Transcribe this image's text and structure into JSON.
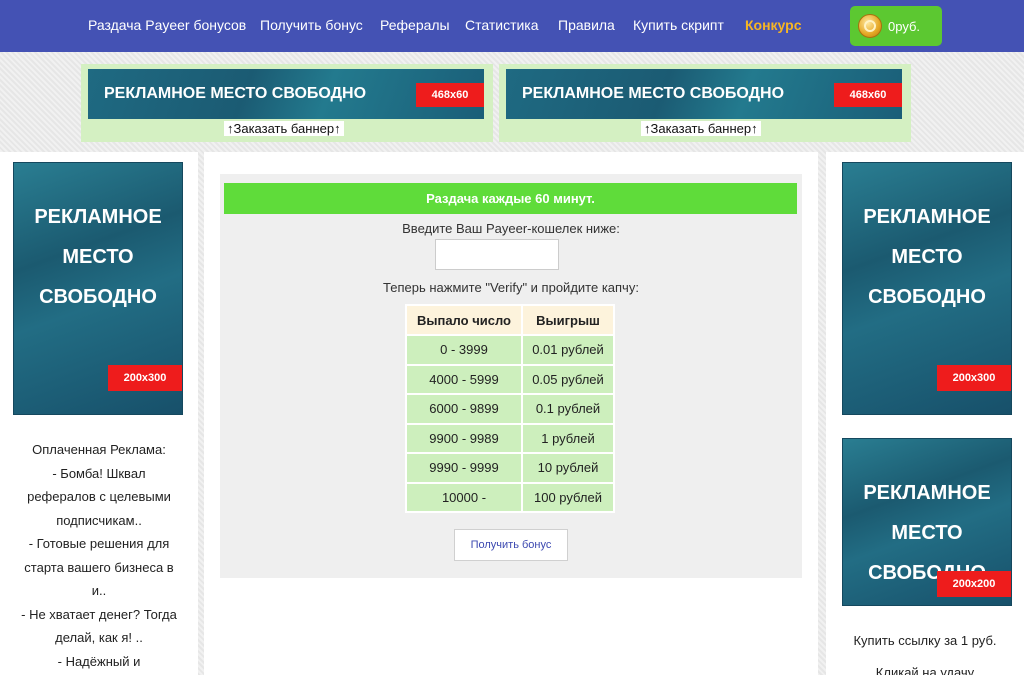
{
  "nav": {
    "items": [
      "Раздача Payeer бонусов",
      "Получить бонус",
      "Рефералы",
      "Статистика",
      "Правила",
      "Купить скрипт"
    ],
    "contest": "Конкурс",
    "balance": "0руб."
  },
  "top_banners": [
    {
      "text": "РЕКЛАМНОЕ  МЕСТО СВОБОДНО",
      "size": "468x60",
      "order": "↑Заказать баннер↑"
    },
    {
      "text": "РЕКЛАМНОЕ  МЕСТО СВОБОДНО",
      "size": "468x60",
      "order": "↑Заказать баннер↑"
    }
  ],
  "side_banners": {
    "left": {
      "lines": [
        "РЕКЛАМНОЕ",
        "МЕСТО",
        "СВОБОДНО"
      ],
      "size": "200x300"
    },
    "right_top": {
      "lines": [
        "РЕКЛАМНОЕ",
        "МЕСТО",
        "СВОБОДНО"
      ],
      "size": "200x300"
    },
    "right_bottom": {
      "lines": [
        "РЕКЛАМНОЕ",
        "МЕСТО",
        "СВОБОДНО"
      ],
      "size": "200x200"
    }
  },
  "paid_ads": {
    "title": "Оплаченная Реклама:",
    "lines": [
      "- Бомба! Шквал",
      "рефералов с целевыми",
      "подписчикам..",
      "- Готовые решения для",
      "старта вашего бизнеса в",
      "и..",
      "- Не хватает денег? Тогда",
      "делай, как я! ..",
      "- Надёжный и"
    ]
  },
  "right_links": {
    "buy_link": "Купить ссылку за 1 руб.",
    "luck": "Кликай на удачу"
  },
  "main": {
    "header": "Раздача каждые 60 минут.",
    "wallet_prompt": "Введите Ваш Payeer-кошелек ниже:",
    "wallet_value": "",
    "verify_prompt": "Теперь нажмите \"Verify\" и пройдите капчу:",
    "table": {
      "headers": [
        "Выпало число",
        "Выигрыш"
      ],
      "rows": [
        [
          "0 - 3999",
          "0.01 рублей"
        ],
        [
          "4000 - 5999",
          "0.05 рублей"
        ],
        [
          "6000 - 9899",
          "0.1 рублей"
        ],
        [
          "9900 - 9989",
          "1 рублей"
        ],
        [
          "9990 - 9999",
          "10 рублей"
        ],
        [
          "10000 -",
          "100 рублей"
        ]
      ]
    },
    "button": "Получить бонус"
  },
  "colors": {
    "nav_bg": "#4452b4",
    "contest": "#f6b524",
    "balance_bg": "#5cc831",
    "header_green": "#5fdc3a",
    "size_tag_red": "#ee1c1c"
  }
}
